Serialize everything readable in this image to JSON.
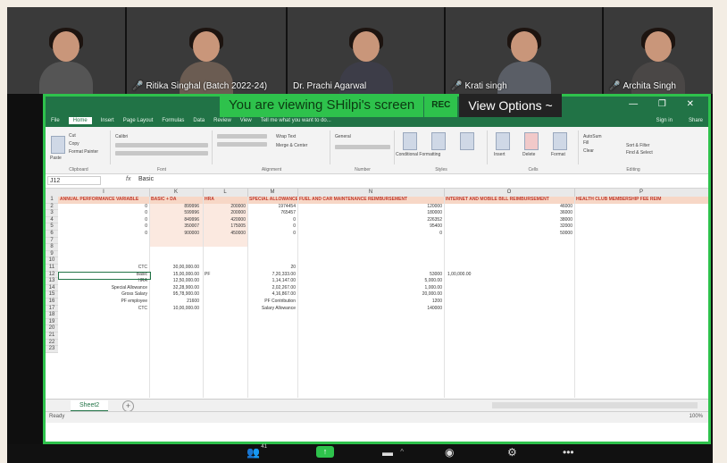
{
  "participants": [
    {
      "name": "",
      "tone": "#5a4a42"
    },
    {
      "name": "Ritika Singhal (Batch 2022-24)",
      "tone": "#6e5a4d"
    },
    {
      "name": "Dr. Prachi Agarwal",
      "tone": "#4b4b55"
    },
    {
      "name": "Krati singh",
      "tone": "#6b6e75"
    },
    {
      "name": "Archita Singh",
      "tone": "#5d5a58"
    }
  ],
  "banner": {
    "viewing": "You are viewing SHilpi's screen",
    "rec": "REC",
    "view_options": "View Options ~"
  },
  "excel": {
    "tabs": [
      "File",
      "Home",
      "Insert",
      "Page Layout",
      "Formulas",
      "Data",
      "Review",
      "View"
    ],
    "tell_me": "Tell me what you want to do...",
    "signin": "Sign in",
    "share": "Share",
    "ribbon_groups": [
      "Clipboard",
      "Font",
      "Alignment",
      "Number",
      "Styles",
      "Cells",
      "Editing"
    ],
    "ribbon_labels": {
      "cut": "Cut",
      "copy": "Copy",
      "format_painter": "Format Painter",
      "paste": "Paste",
      "font": "Calibri",
      "wrap": "Wrap Text",
      "merge": "Merge & Center",
      "number_format": "General",
      "cond_format": "Conditional Formatting",
      "format_table": "Format as Table",
      "cell_styles": "Cell Styles",
      "insert": "Insert",
      "delete": "Delete",
      "format": "Format",
      "autosum": "AutoSum",
      "fill": "Fill",
      "clear": "Clear",
      "sort": "Sort & Filter",
      "find": "Find & Select"
    },
    "name_box": "J12",
    "fx": "fx",
    "formula_value": "Basic",
    "columns": [
      "I",
      "J",
      "K",
      "L",
      "M",
      "N",
      "O",
      "P"
    ],
    "headers": {
      "i": "ANNUAL PERFORMANCE VARIABLE",
      "k": "BASIC + DA",
      "l": "HRA",
      "m": "SPECIAL ALLOWANCE",
      "n": "FUEL AND CAR MAINTENANCE REIMBURSEMENT",
      "o": "INTERNET AND MOBILE BILL REIMBURSEMENT",
      "p": "HEALTH CLUB MEMBERSHIP FEE REIM"
    },
    "top_rows": [
      {
        "i": "0",
        "k": "899996",
        "l": "200000",
        "m": "1974454",
        "n": "120000",
        "o": "46000"
      },
      {
        "i": "0",
        "k": "599996",
        "l": "200000",
        "m": "765457",
        "n": "180000",
        "o": "36000"
      },
      {
        "i": "0",
        "k": "849996",
        "l": "420000",
        "m": "0",
        "n": "226352",
        "o": "38000"
      },
      {
        "i": "0",
        "k": "350007",
        "l": "175005",
        "m": "0",
        "n": "95400",
        "o": "32000"
      },
      {
        "i": "0",
        "k": "900000",
        "l": "450000",
        "m": "0",
        "n": "0",
        "o": "50000"
      }
    ],
    "calc_rows": [
      {
        "label": "CTC",
        "k": "30,00,000.00",
        "l": "",
        "m": "20",
        "n": "",
        "o": ""
      },
      {
        "label": "Basic",
        "k": "15,00,000.00",
        "l": "PF",
        "m": "7,20,333.00",
        "n": "53000",
        "o": "1,00,000.00"
      },
      {
        "label": "HRA",
        "k": "12,50,000.00",
        "l": "",
        "m": "1,14,147.00",
        "n": "5,000.00",
        "o": ""
      },
      {
        "label": "Special Allowance",
        "k": "32,28,900.00",
        "l": "",
        "m": "2,02,267.00",
        "n": "1,000.00",
        "o": ""
      },
      {
        "label": "Gross Salary",
        "k": "95,78,900.00",
        "l": "",
        "m": "4,16,867.00",
        "n": "20,000.00",
        "o": ""
      },
      {
        "label": "PF employee",
        "k": "21600",
        "l": "",
        "m": "PF Contribution",
        "n": "1200",
        "o": ""
      },
      {
        "label": "CTC",
        "k": "10,00,000.00",
        "l": "",
        "m": "Salary Allowance",
        "n": "140000",
        "o": ""
      }
    ],
    "row_numbers": [
      "1",
      "2",
      "3",
      "4",
      "5",
      "6",
      "7",
      "8",
      "9",
      "10",
      "11",
      "12",
      "13",
      "14",
      "15",
      "16",
      "17",
      "18",
      "19",
      "20",
      "21",
      "22",
      "23"
    ],
    "sheet_tab": "Sheet2",
    "add_sheet": "+",
    "status": "Ready",
    "zoom": "100%"
  },
  "toolbar": {
    "participants_count": "41",
    "items": [
      {
        "name": "participants",
        "icon": "people-icon",
        "glyph": "👥"
      },
      {
        "name": "share-screen",
        "icon": "share-screen-icon",
        "glyph": "↑"
      },
      {
        "name": "chat",
        "icon": "chat-icon",
        "glyph": "💬"
      },
      {
        "name": "reactions",
        "icon": "reactions-icon",
        "glyph": "☺"
      },
      {
        "name": "settings",
        "icon": "gear-icon",
        "glyph": "⚙"
      },
      {
        "name": "more",
        "icon": "more-icon",
        "glyph": "•••"
      }
    ]
  },
  "colors": {
    "zoom_green": "#2ec24c",
    "excel_green": "#217346",
    "header_fill": "#f7d7c6",
    "header_text": "#c0392b"
  }
}
